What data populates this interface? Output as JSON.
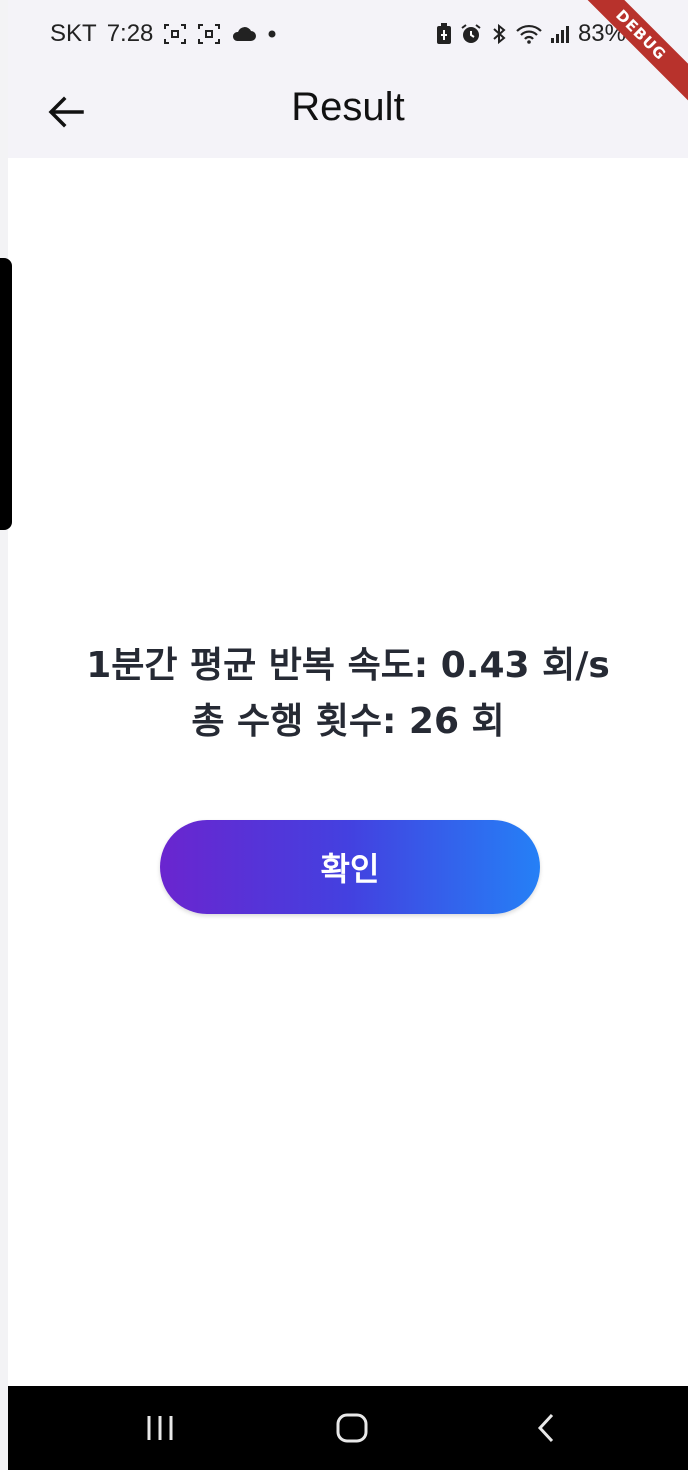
{
  "status_bar": {
    "carrier": "SKT",
    "time": "7:28",
    "battery": "83%",
    "icons": [
      "screenshot-icon",
      "screenshot-icon",
      "cloud-icon",
      "dot-icon",
      "battery-saver-icon",
      "alarm-icon",
      "bluetooth-icon",
      "wifi-icon",
      "signal-icon",
      "battery-icon"
    ]
  },
  "app_bar": {
    "title": "Result",
    "back_icon": "arrow-left-icon"
  },
  "debug_banner": "DEBUG",
  "result": {
    "line1": "1분간 평균 반복 속도: 0.43 회/s",
    "line2": "총 수행 횟수: 26 회"
  },
  "confirm_button": {
    "label": "확인",
    "gradient_start": "#6a25cf",
    "gradient_end": "#2580f6"
  },
  "nav_bar": {
    "items": [
      "recents-icon",
      "home-icon",
      "back-icon"
    ]
  }
}
